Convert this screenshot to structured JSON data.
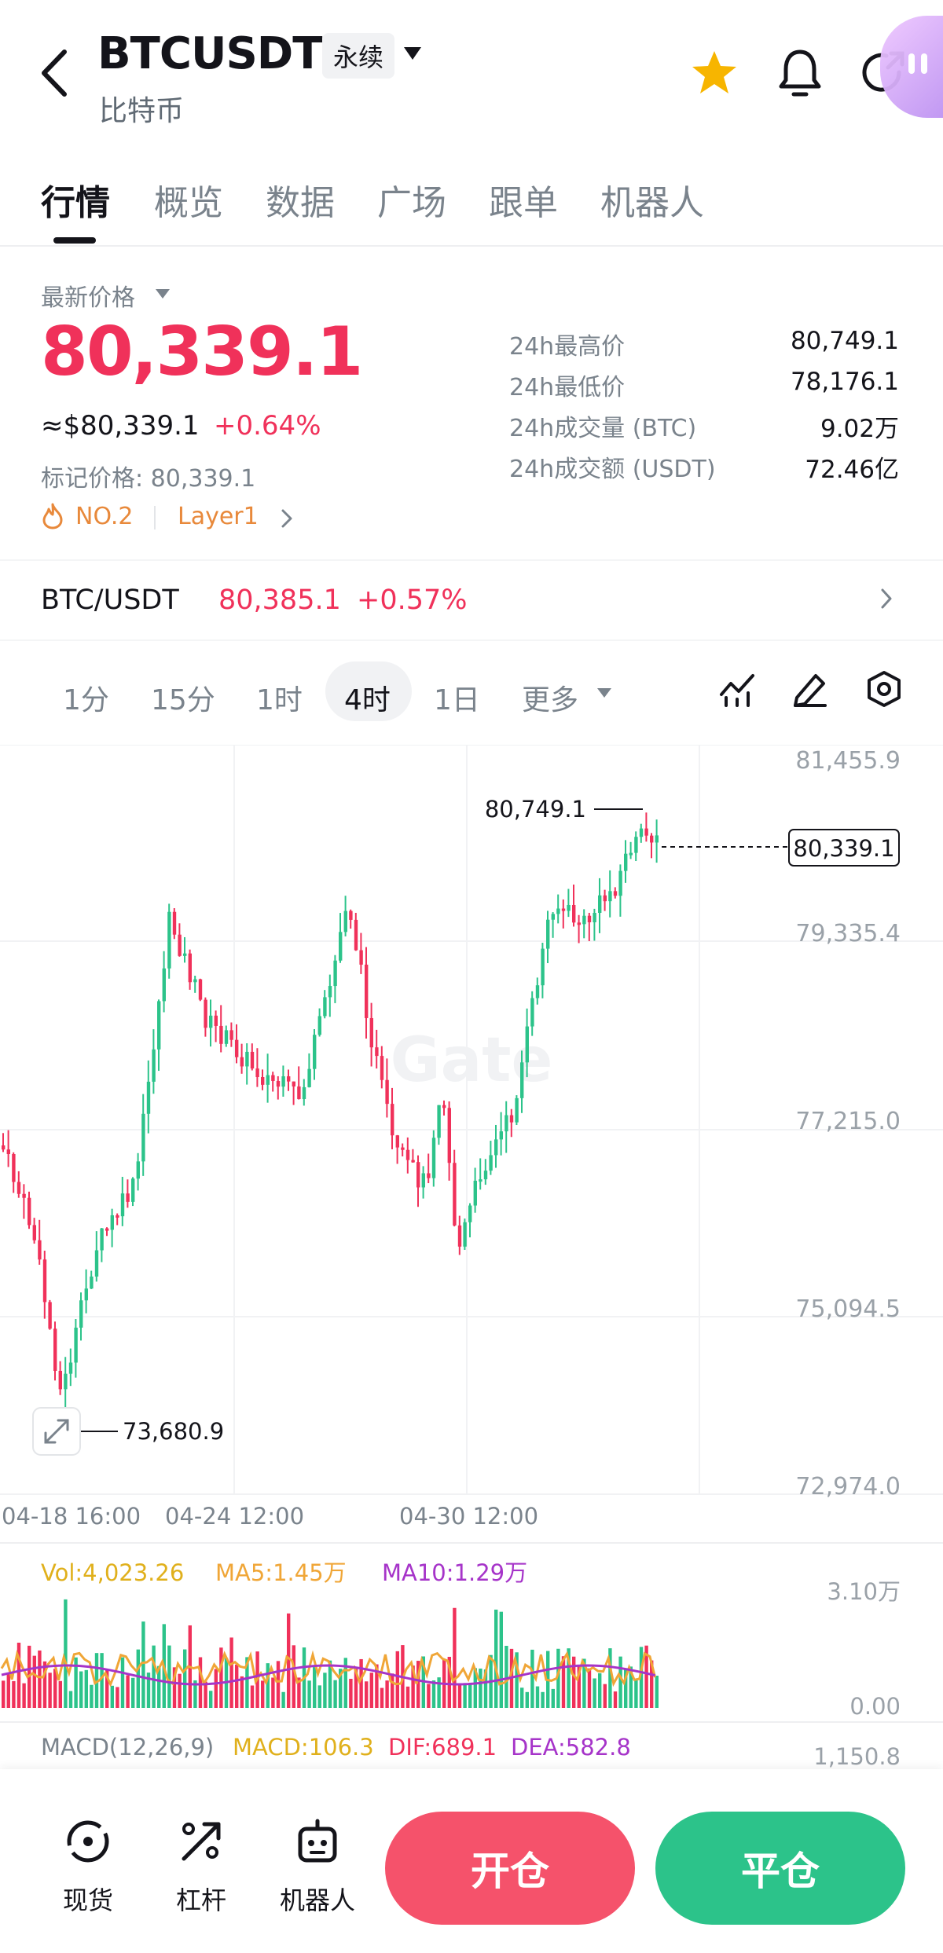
{
  "header": {
    "title": "BTCUSDT",
    "badge": "永续",
    "subtitle": "比特币"
  },
  "tabs": [
    "行情",
    "概览",
    "数据",
    "广场",
    "跟单",
    "机器人"
  ],
  "active_tab": "行情",
  "price": {
    "label": "最新价格",
    "last": "80,339.1",
    "usd": "≈$80,339.1",
    "change_pct": "+0.64%",
    "mark_price": "标记价格: 80,339.1",
    "rank": "NO.2",
    "sector": "Layer1"
  },
  "stats": [
    {
      "label": "24h最高价",
      "value": "80,749.1"
    },
    {
      "label": "24h最低价",
      "value": "78,176.1"
    },
    {
      "label": "24h成交量 (BTC)",
      "value": "9.02万"
    },
    {
      "label": "24h成交额 (USDT)",
      "value": "72.46亿"
    }
  ],
  "spot": {
    "pair": "BTC/USDT",
    "price": "80,385.1",
    "change": "+0.57%"
  },
  "intervals": [
    "1分",
    "15分",
    "1时",
    "4时",
    "1日",
    "更多"
  ],
  "active_interval": "4时",
  "chart": {
    "price_ticks": [
      "81,455.9",
      "79,335.4",
      "77,215.0",
      "75,094.5",
      "72,974.0"
    ],
    "time_ticks": [
      "04-18 16:00",
      "04-24 12:00",
      "04-30 12:00"
    ],
    "high_label": "80,749.1",
    "low_label": "73,680.9",
    "current_label": "80,339.1",
    "watermark": "Gate",
    "vol_label": "Vol:4,023.26",
    "ma5_label": "MA5:1.45万",
    "ma10_label": "MA10:1.29万",
    "vol_max": "3.10万",
    "vol_min": "0.00",
    "macd_title": "MACD(12,26,9)",
    "macd_label": "MACD:106.3",
    "dif_label": "DIF:689.1",
    "dea_label": "DEA:582.8",
    "macd_tick": "1,150.8",
    "colors": {
      "up": "#2cc38a",
      "down": "#f0315a",
      "ma5": "#f0a637",
      "ma10": "#a634c9"
    }
  },
  "bottom": {
    "spot_label": "现货",
    "margin_label": "杠杆",
    "bot_label": "机器人",
    "open": "开仓",
    "close": "平仓"
  }
}
